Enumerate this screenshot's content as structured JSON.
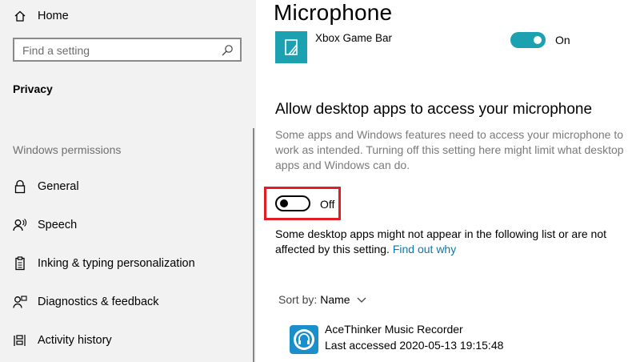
{
  "sidebar": {
    "home_label": "Home",
    "search_placeholder": "Find a setting",
    "section": "Privacy",
    "category": "Windows permissions",
    "items": [
      {
        "label": "General",
        "icon": "lock-icon"
      },
      {
        "label": "Speech",
        "icon": "speech-icon"
      },
      {
        "label": "Inking & typing personalization",
        "icon": "clipboard-icon"
      },
      {
        "label": "Diagnostics & feedback",
        "icon": "person-feedback-icon"
      },
      {
        "label": "Activity history",
        "icon": "timeline-icon"
      }
    ]
  },
  "main": {
    "title": "Microphone",
    "xbox_app": {
      "name": "Xbox Game Bar",
      "state": "On"
    },
    "desktop_heading": "Allow desktop apps to access your microphone",
    "desktop_desc": "Some apps and Windows features need to access your microphone to work as intended. Turning off this setting here might limit what desktop apps and Windows can do.",
    "desktop_toggle_state": "Off",
    "note_text": "Some desktop apps might not appear in the following list or are not affected by this setting. ",
    "note_link": "Find out why",
    "sort_label": "Sort by:",
    "sort_value": "Name",
    "apps": [
      {
        "name": "AceThinker Music Recorder",
        "last_accessed": "Last accessed 2020-05-13 19:15:48"
      }
    ]
  },
  "colors": {
    "accent": "#1ba1b0",
    "highlight": "#e21d25",
    "link": "#0a7aa8"
  }
}
